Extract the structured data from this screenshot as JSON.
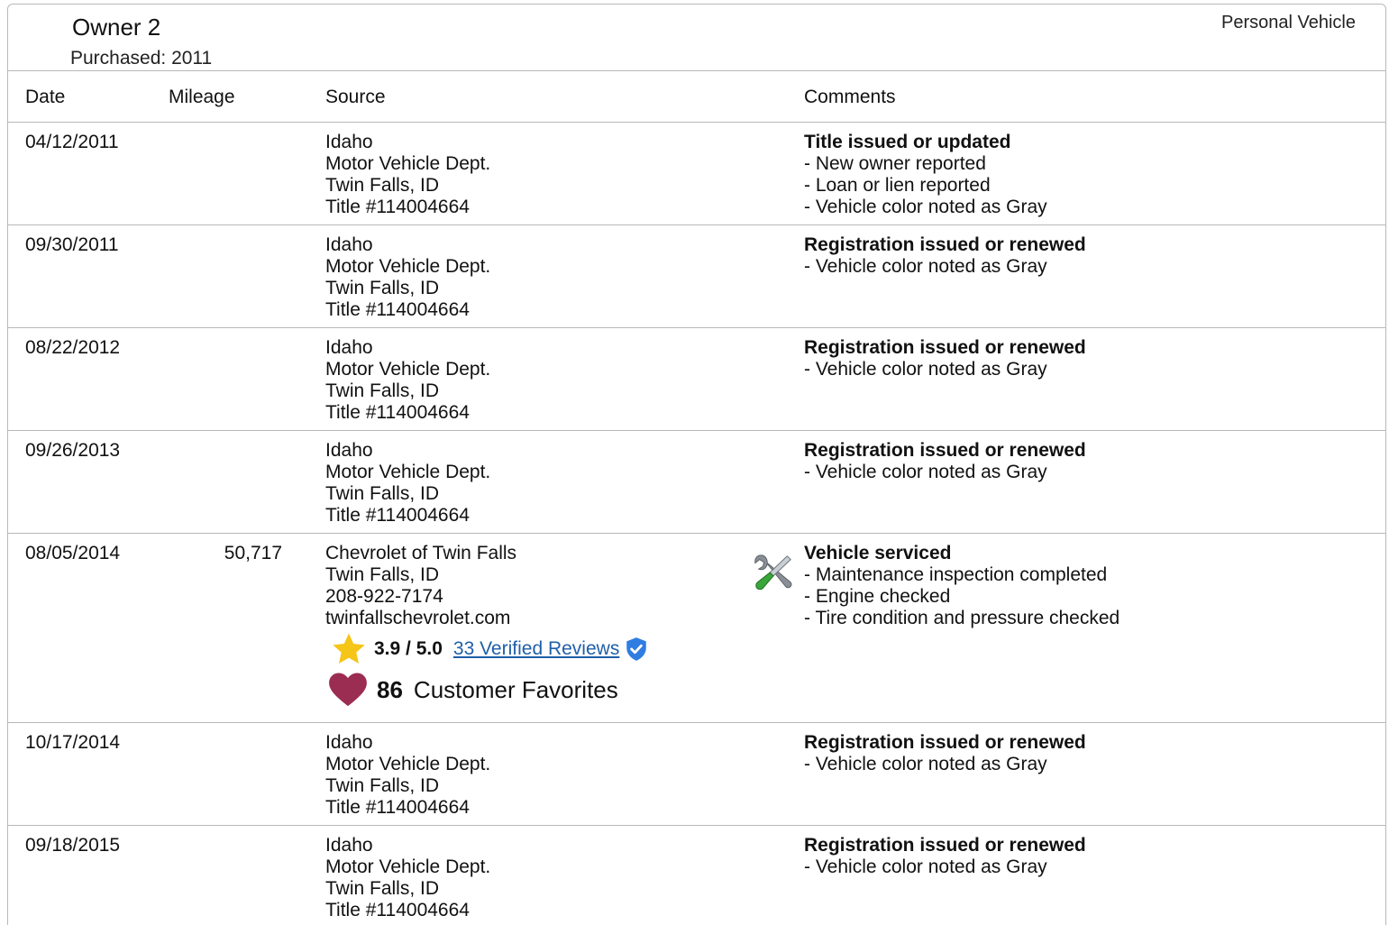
{
  "owner": {
    "title": "Owner 2",
    "purchased": "Purchased: 2011",
    "vehicle_type": "Personal Vehicle"
  },
  "columns": {
    "date": "Date",
    "mileage": "Mileage",
    "source": "Source",
    "comments": "Comments"
  },
  "records": [
    {
      "date": "04/12/2011",
      "mileage": "",
      "source": [
        "Idaho",
        "Motor Vehicle Dept.",
        "Twin Falls, ID",
        "Title #114004664"
      ],
      "comment_title": "Title issued or updated",
      "comments": [
        "- New owner reported",
        "- Loan or lien reported",
        "- Vehicle color noted as Gray"
      ]
    },
    {
      "date": "09/30/2011",
      "mileage": "",
      "source": [
        "Idaho",
        "Motor Vehicle Dept.",
        "Twin Falls, ID",
        "Title #114004664"
      ],
      "comment_title": "Registration issued or renewed",
      "comments": [
        "- Vehicle color noted as Gray"
      ]
    },
    {
      "date": "08/22/2012",
      "mileage": "",
      "source": [
        "Idaho",
        "Motor Vehicle Dept.",
        "Twin Falls, ID",
        "Title #114004664"
      ],
      "comment_title": "Registration issued or renewed",
      "comments": [
        "- Vehicle color noted as Gray"
      ]
    },
    {
      "date": "09/26/2013",
      "mileage": "",
      "source": [
        "Idaho",
        "Motor Vehicle Dept.",
        "Twin Falls, ID",
        "Title #114004664"
      ],
      "comment_title": "Registration issued or renewed",
      "comments": [
        "- Vehicle color noted as Gray"
      ]
    },
    {
      "date": "08/05/2014",
      "mileage": "50,717",
      "source": [
        "Chevrolet of Twin Falls",
        "Twin Falls, ID",
        "208-922-7174",
        "twinfallschevrolet.com"
      ],
      "comment_title": "Vehicle serviced",
      "comments": [
        "- Maintenance inspection completed",
        "- Engine checked",
        "- Tire condition and pressure checked"
      ],
      "service_icon": "wrench-screwdriver-icon",
      "rating": "3.9 / 5.0",
      "reviews_link": "33 Verified Reviews",
      "favorites_count": "86",
      "favorites_label": "Customer Favorites"
    },
    {
      "date": "10/17/2014",
      "mileage": "",
      "source": [
        "Idaho",
        "Motor Vehicle Dept.",
        "Twin Falls, ID",
        "Title #114004664"
      ],
      "comment_title": "Registration issued or renewed",
      "comments": [
        "- Vehicle color noted as Gray"
      ]
    },
    {
      "date": "09/18/2015",
      "mileage": "",
      "source": [
        "Idaho",
        "Motor Vehicle Dept.",
        "Twin Falls, ID",
        "Title #114004664"
      ],
      "comment_title": "Registration issued or renewed",
      "comments": [
        "- Vehicle color noted as Gray"
      ]
    }
  ],
  "colors": {
    "border": "#b8b8b8",
    "link": "#1f5fa8",
    "star": "#f5c518",
    "heart": "#9b2d52",
    "verified": "#2f7de1"
  }
}
